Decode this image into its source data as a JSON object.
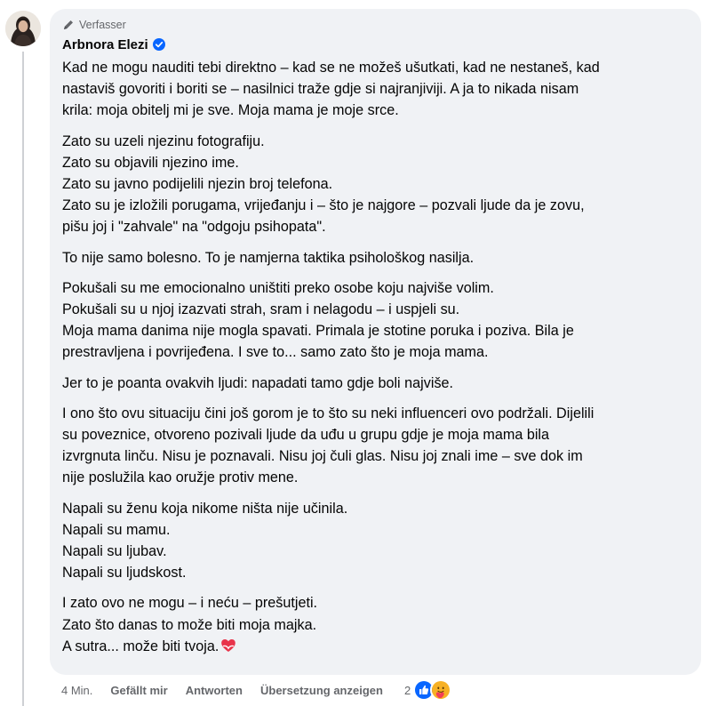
{
  "comment": {
    "badge_label": "Verfasser",
    "author_name": "Arbnora Elezi",
    "paragraphs": [
      [
        "Kad ne mogu nauditi tebi direktno – kad se ne možeš ušutkati, kad ne nestaneš, kad",
        "nastaviš govoriti i boriti se – nasilnici traže gdje si najranjiviji. A ja to nikada nisam",
        "krila: moja obitelj mi je sve. Moja mama je moje srce."
      ],
      [
        "Zato su uzeli njezinu fotografiju.",
        "Zato su objavili njezino ime.",
        "Zato su javno podijelili njezin broj telefona.",
        "Zato su je izložili porugama, vrijeđanju i – što je najgore – pozvali ljude da je zovu,",
        "pišu joj i \"zahvale\" na \"odgoju psihopata\"."
      ],
      [
        "To nije samo bolesno. To je namjerna taktika psihološkog nasilja."
      ],
      [
        "Pokušali su me emocionalno uništiti preko osobe koju najviše volim.",
        "Pokušali su u njoj izazvati strah, sram i nelagodu – i uspjeli su.",
        "Moja mama danima nije mogla spavati. Primala je stotine poruka i poziva. Bila je",
        "prestravljena i povrijeđena. I sve to... samo zato što je moja mama."
      ],
      [
        "Jer to je poanta ovakvih ljudi: napadati tamo gdje boli najviše."
      ],
      [
        "I ono što ovu situaciju čini još gorom je to što su neki influenceri ovo podržali. Dijelili",
        "su poveznice, otvoreno pozivali ljude da uđu u grupu gdje je moja mama bila",
        "izvrgnuta linču. Nisu je poznavali. Nisu joj čuli glas. Nisu joj znali ime – sve dok im",
        "nije poslužila kao oružje protiv mene."
      ],
      [
        "Napali su ženu koja nikome ništa nije učinila.",
        "Napali su mamu.",
        "Napali su ljubav.",
        "Napali su ljudskost."
      ],
      [
        "I zato ovo ne mogu – i neću – prešutjeti.",
        "Zato što danas to može biti moja majka.",
        "A sutra... može biti tvoja."
      ]
    ]
  },
  "actions": {
    "time": "4 Min.",
    "like": "Gefällt mir",
    "reply": "Antworten",
    "translate": "Übersetzung anzeigen"
  },
  "reactions": {
    "count": "2",
    "icons": [
      "like-icon",
      "care-icon"
    ]
  },
  "icons": {
    "badge": "pencil-icon",
    "verified": "verified-badge-icon",
    "end_emoji": "heart-emoji-icon"
  },
  "colors": {
    "bubble": "#f0f2f5",
    "verified": "#0866ff",
    "like": "#0866ff",
    "meta_text": "#65676b"
  }
}
